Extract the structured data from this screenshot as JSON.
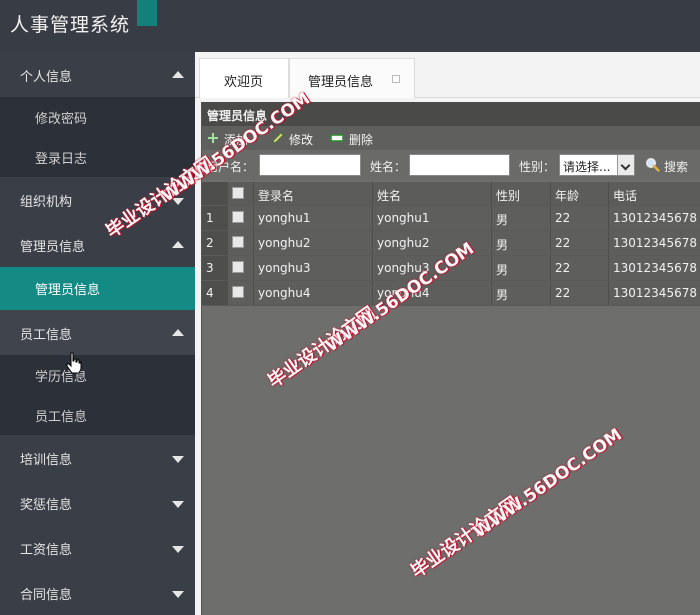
{
  "app": {
    "title": "人事管理系统"
  },
  "sidebar": {
    "groups": [
      {
        "label": "个人信息",
        "expanded": true,
        "items": [
          "修改密码",
          "登录日志"
        ]
      },
      {
        "label": "组织机构",
        "expanded": false,
        "items": []
      },
      {
        "label": "管理员信息",
        "expanded": true,
        "items": [
          "管理员信息"
        ]
      },
      {
        "label": "员工信息",
        "expanded": true,
        "items": [
          "学历信息",
          "员工信息"
        ]
      },
      {
        "label": "培训信息",
        "expanded": false,
        "items": []
      },
      {
        "label": "奖惩信息",
        "expanded": false,
        "items": []
      },
      {
        "label": "工资信息",
        "expanded": false,
        "items": []
      },
      {
        "label": "合同信息",
        "expanded": false,
        "items": []
      }
    ],
    "active_item": "管理员信息"
  },
  "tabs": [
    {
      "label": "欢迎页"
    },
    {
      "label": "管理员信息",
      "closable": true
    }
  ],
  "panel": {
    "title": "管理员信息",
    "toolbar": {
      "add": "添加",
      "edit": "修改",
      "delete": "删除"
    },
    "search": {
      "username_label": "用户名：",
      "name_label": "姓名：",
      "gender_label": "性别：",
      "gender_selected": "请选择...",
      "search_button": "搜索"
    },
    "grid": {
      "columns": [
        "登录名",
        "姓名",
        "性别",
        "年龄",
        "电话"
      ],
      "rows": [
        {
          "no": "1",
          "login": "yonghu1",
          "name": "yonghu1",
          "gender": "男",
          "age": "22",
          "phone": "13012345678"
        },
        {
          "no": "2",
          "login": "yonghu2",
          "name": "yonghu2",
          "gender": "男",
          "age": "22",
          "phone": "13012345678"
        },
        {
          "no": "3",
          "login": "yonghu3",
          "name": "yonghu3",
          "gender": "男",
          "age": "22",
          "phone": "13012345678"
        },
        {
          "no": "4",
          "login": "yonghu4",
          "name": "yonghu4",
          "gender": "男",
          "age": "22",
          "phone": "13012345678"
        }
      ]
    }
  },
  "watermarks": {
    "cn": "毕业设计论文网",
    "url": "WWW.56DOC.COM"
  },
  "colors": {
    "accent": "#138a83",
    "sidebar_bg": "#3a3f47",
    "sidebar_sub_bg": "#2c3038",
    "watermark_red": "#c8102e"
  },
  "icons": {
    "expand_up": "triangle-up",
    "expand_down": "triangle-down",
    "add": "plus-icon",
    "edit": "pencil-icon",
    "delete": "minus-box-icon",
    "search": "magnifier-icon"
  }
}
